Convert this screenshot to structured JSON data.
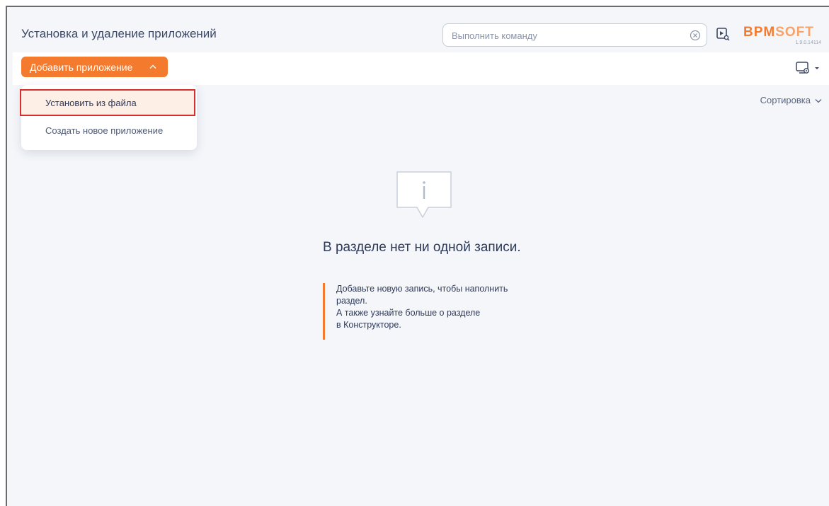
{
  "header": {
    "title": "Установка и удаление приложений",
    "command_placeholder": "Выполнить команду",
    "logo_text_main": "BPM",
    "logo_text_soft": "SOFT",
    "version": "1.9.0.14114"
  },
  "toolbar": {
    "add_app_label": "Добавить приложение"
  },
  "dropdown": {
    "items": [
      {
        "label": "Установить из файла"
      },
      {
        "label": "Создать новое приложение"
      }
    ]
  },
  "sort": {
    "label": "Сортировка"
  },
  "empty_state": {
    "title": "В разделе нет ни одной записи.",
    "hint_lines": [
      "Добавьте новую запись, чтобы наполнить",
      "раздел.",
      "А также узнайте больше о разделе",
      "в Конструкторе."
    ]
  },
  "colors": {
    "accent": "#f47a2e",
    "highlight_border": "#d62d2d",
    "background": "#f4f6fa"
  },
  "icons": {
    "clear": "clear-circle-icon",
    "run": "run-command-icon",
    "chevron": "chevron-up-icon",
    "view_settings": "view-settings-icon",
    "sort_chevron": "chevron-down-icon",
    "empty": "info-bubble-icon"
  }
}
